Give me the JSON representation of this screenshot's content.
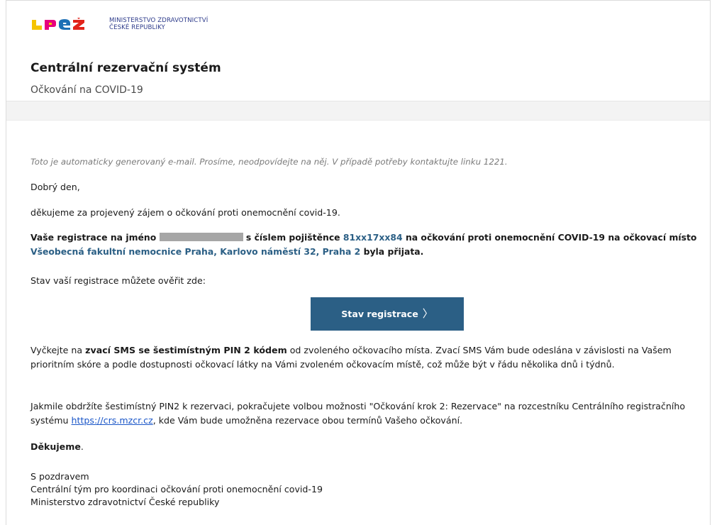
{
  "header": {
    "ministry_line1": "MINISTERSTVO ZDRAVOTNICTVÍ",
    "ministry_line2": "ČESKÉ REPUBLIKY",
    "app_title": "Centrální rezervační systém",
    "app_subtitle": "Očkování na COVID-19"
  },
  "colors": {
    "brand_blue": "#2b5f85",
    "logo_yellow": "#f5c400",
    "logo_pink": "#e6007e",
    "logo_blue": "#1b6fb5",
    "logo_red": "#e2231a"
  },
  "email": {
    "notice": "Toto je automaticky generovaný e-mail. Prosíme, neodpovídejte na něj. V případě potřeby kontaktujte linku 1221.",
    "greeting": "Dobrý den,",
    "thanks_interest": "děkujeme za projevený zájem o očkování proti onemocnění covid-19.",
    "registration": {
      "prefix": "Vaše registrace na jméno",
      "insurance_label": "s číslem pojištěnce",
      "insurance_number": "81xx17xx84",
      "middle": "na očkování proti onemocnění COVID-19 na očkovací místo",
      "place": "Všeobecná fakultní nemocnice Praha, Karlovo náměstí 32, Praha 2",
      "suffix": "byla přijata."
    },
    "status_text": "Stav vaší registrace můžete ověřit zde:",
    "button_label": "Stav registrace",
    "wait": {
      "prefix": "Vyčkejte na",
      "bold": "zvací SMS se šestimístným PIN 2 kódem",
      "rest": "od zvoleného očkovacího místa. Zvací SMS Vám bude odeslána v závislosti na Vašem prioritním skóre a podle dostupnosti očkovací látky na Vámi zvoleném očkovacím místě, což může být v řádu několika dnů i týdnů."
    },
    "once": {
      "text": "Jakmile obdržíte šestimístný PIN2 k rezervaci, pokračujete volbou možnosti \"Očkování krok 2: Rezervace\" na rozcestníku Centrálního registračního systému",
      "link": "https://crs.mzcr.cz",
      "after": ", kde Vám bude umožněna rezervace obou termínů Vašeho očkování."
    },
    "thanks_bold": "Děkujeme",
    "thanks_dot": ".",
    "signature": {
      "line1": "S pozdravem",
      "line2": "Centrální tým pro koordinaci očkování proti onemocnění covid-19",
      "line3": "Ministerstvo zdravotnictví České republiky"
    }
  }
}
